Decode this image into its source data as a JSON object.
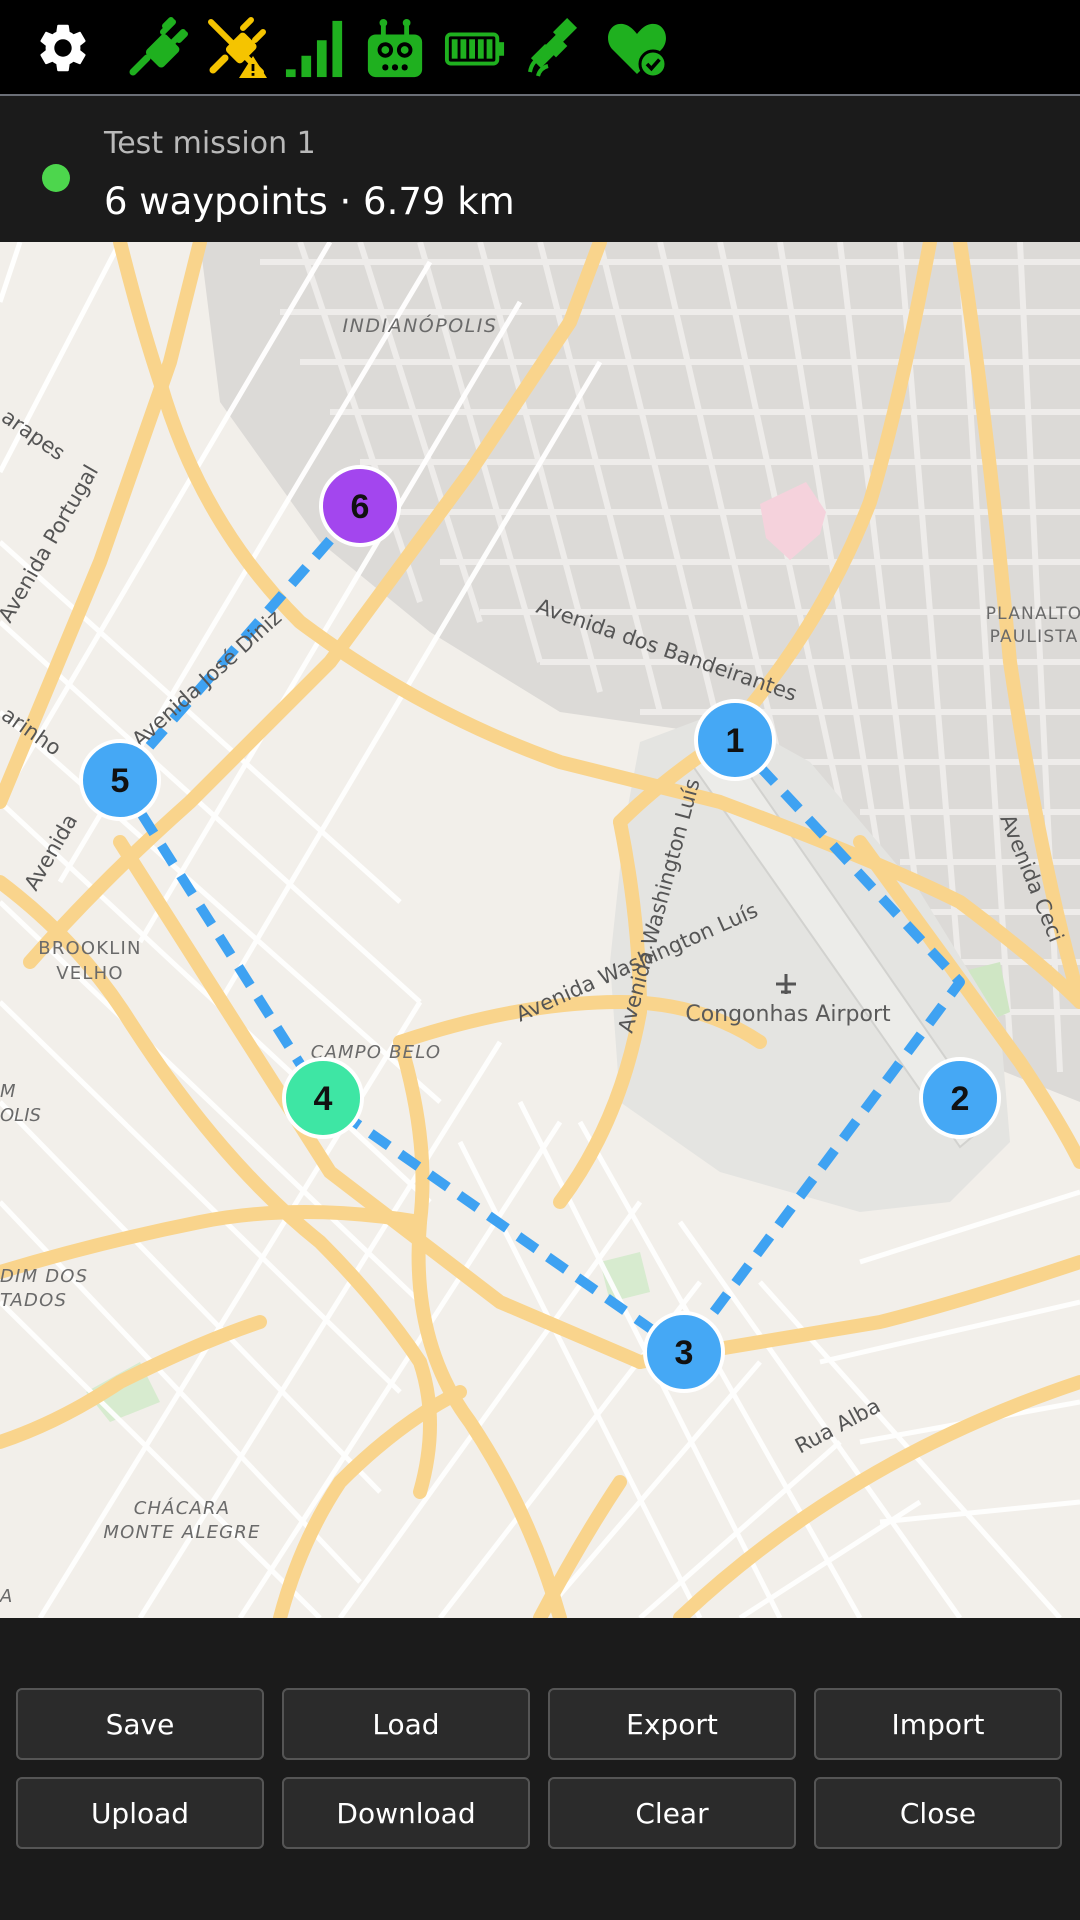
{
  "status_icons": [
    {
      "name": "settings-gear-icon",
      "color": "#ffffff"
    },
    {
      "name": "plug-connected-icon",
      "color": "#1fb01f"
    },
    {
      "name": "plug-disconnected-warning-icon",
      "color": "#f5c400"
    },
    {
      "name": "signal-strength-icon",
      "color": "#1fb01f"
    },
    {
      "name": "robot-icon",
      "color": "#1fb01f"
    },
    {
      "name": "battery-icon",
      "color": "#1fb01f"
    },
    {
      "name": "satellite-icon",
      "color": "#1fb01f"
    },
    {
      "name": "health-heart-check-icon",
      "color": "#1fb01f"
    }
  ],
  "mission": {
    "name": "Test mission 1",
    "summary": "6 waypoints · 6.79 km",
    "status_color": "#4dd64d"
  },
  "map": {
    "labels": {
      "indianopolis": "INDIANÓPOLIS",
      "planalto1": "PLANALTO",
      "planalto2": "PAULISTA",
      "brooklin1": "BROOKLIN",
      "brooklin2": "VELHO",
      "campo_belo": "CAMPO BELO",
      "jardim1": "DIM DOS",
      "jardim2": "TADOS",
      "chacara1": "CHÁCARA",
      "chacara2": "MONTE ALEGRE",
      "m_fragment": "M",
      "olis_fragment": "OLIS",
      "a_fragment": "A",
      "airport": "Congonhas Airport",
      "av_bandeirantes": "Avenida dos Bandeirantes",
      "av_washington": "Avenida Washington Luís",
      "av_portugal": "Avenida Portugal",
      "av_ceci": "Avenida Ceci",
      "rua_alba": "Rua Alba",
      "av_jose_diniz": "Avenida José Diniz",
      "marinho": "arinho",
      "arapes": "arapes",
      "avenida_left": "Avenida"
    },
    "route_color": "#3ea2f2",
    "waypoints": [
      {
        "label": "1",
        "color": "#45a8f5"
      },
      {
        "label": "2",
        "color": "#45a8f5"
      },
      {
        "label": "3",
        "color": "#45a8f5"
      },
      {
        "label": "4",
        "color": "#3ee6a4"
      },
      {
        "label": "5",
        "color": "#45a8f5"
      },
      {
        "label": "6",
        "color": "#a346ee"
      }
    ]
  },
  "buttons": {
    "save": "Save",
    "load": "Load",
    "export": "Export",
    "import": "Import",
    "upload": "Upload",
    "download": "Download",
    "clear": "Clear",
    "close": "Close"
  }
}
